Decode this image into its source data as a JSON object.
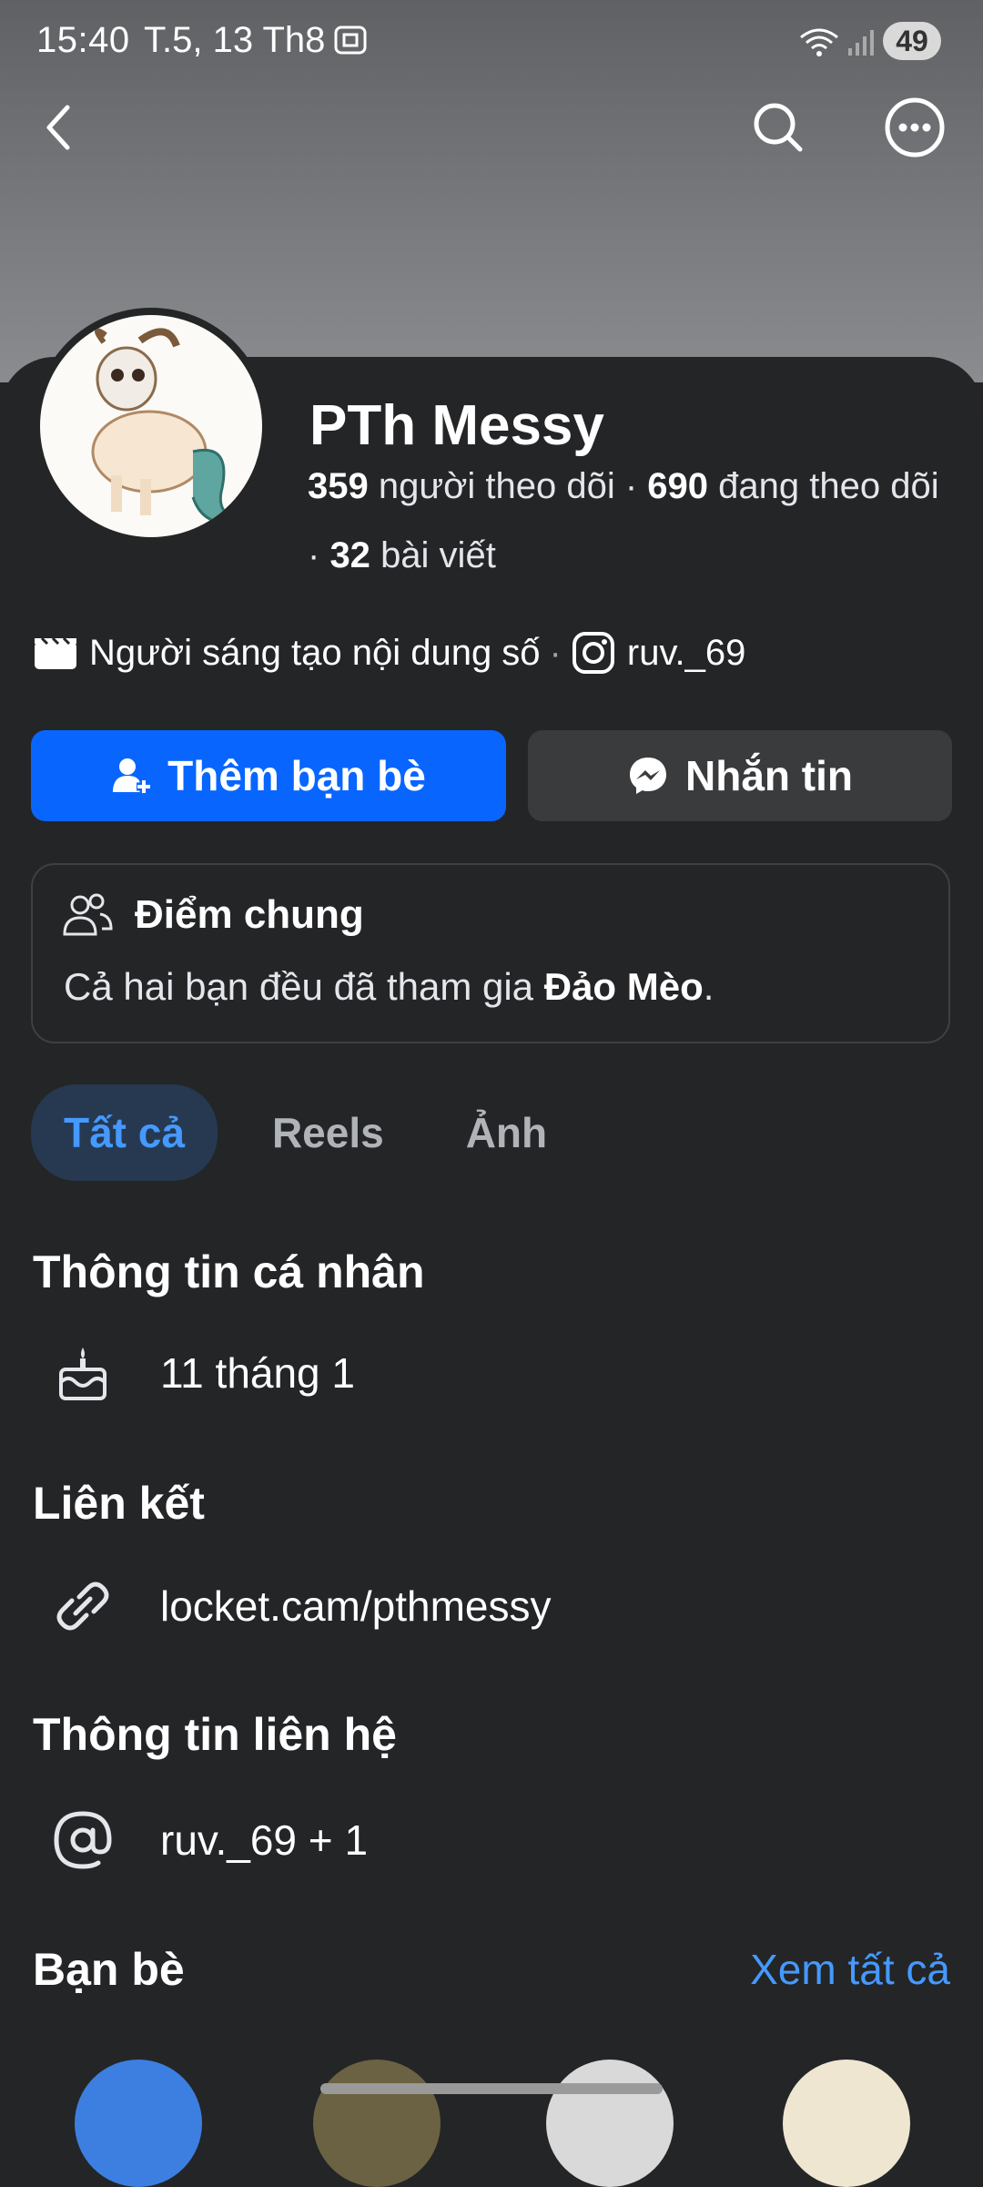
{
  "status_bar": {
    "time": "15:40",
    "date": "T.5, 13 Th8",
    "battery": "49"
  },
  "profile": {
    "name": "PTh Messy",
    "followers_count": "359",
    "followers_label": "người theo dõi",
    "following_count": "690",
    "following_label": "đang theo dõi",
    "posts_count": "32",
    "posts_label": "bài viết",
    "creator_label": "Người sáng tạo nội dung số",
    "instagram": "ruv._69"
  },
  "actions": {
    "add_friend": "Thêm bạn bè",
    "message": "Nhắn tin"
  },
  "mutual": {
    "title": "Điểm chung",
    "desc_prefix": "Cả hai bạn đều đã tham gia ",
    "group": "Đảo Mèo",
    "desc_suffix": "."
  },
  "tabs": [
    "Tất cả",
    "Reels",
    "Ảnh"
  ],
  "sections": {
    "personal_info": "Thông tin cá nhân",
    "birthday": "11 tháng 1",
    "links": "Liên kết",
    "link_value": "locket.cam/pthmessy",
    "contact": "Thông tin liên hệ",
    "contact_value": "ruv._69 + 1",
    "friends": "Bạn bè",
    "see_all": "Xem tất cả"
  },
  "colors": {
    "accent": "#0866ff",
    "link": "#4599ff",
    "background": "#242527"
  }
}
